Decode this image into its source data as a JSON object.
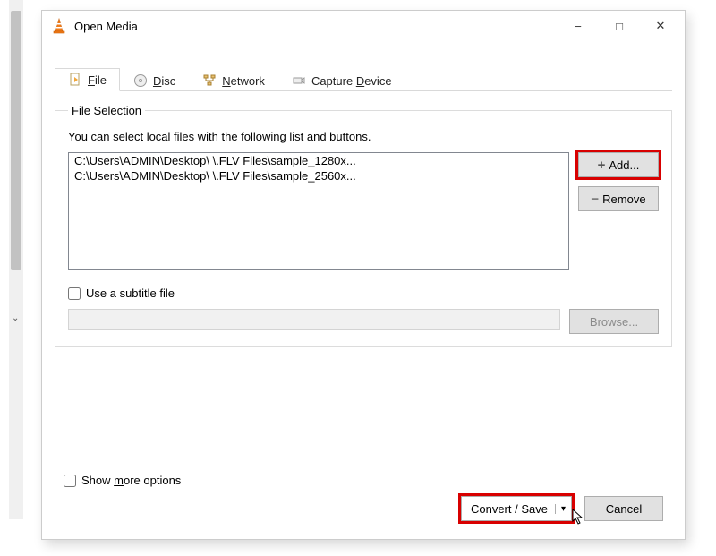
{
  "window": {
    "title": "Open Media"
  },
  "tabs": {
    "file": "File",
    "disc": "Disc",
    "network": "Network",
    "capture": "Capture Device"
  },
  "fileSelection": {
    "legend": "File Selection",
    "help": "You can select local files with the following list and buttons.",
    "files": [
      "C:\\Users\\ADMIN\\Desktop\\                        \\.FLV Files\\sample_1280x...",
      "C:\\Users\\ADMIN\\Desktop\\                        \\.FLV Files\\sample_2560x..."
    ],
    "addLabel": "Add...",
    "removeLabel": "Remove"
  },
  "subtitle": {
    "checkboxLabel": "Use a subtitle file",
    "browseLabel": "Browse..."
  },
  "showMore": "Show more options",
  "bottom": {
    "convert": "Convert / Save",
    "cancel": "Cancel"
  }
}
